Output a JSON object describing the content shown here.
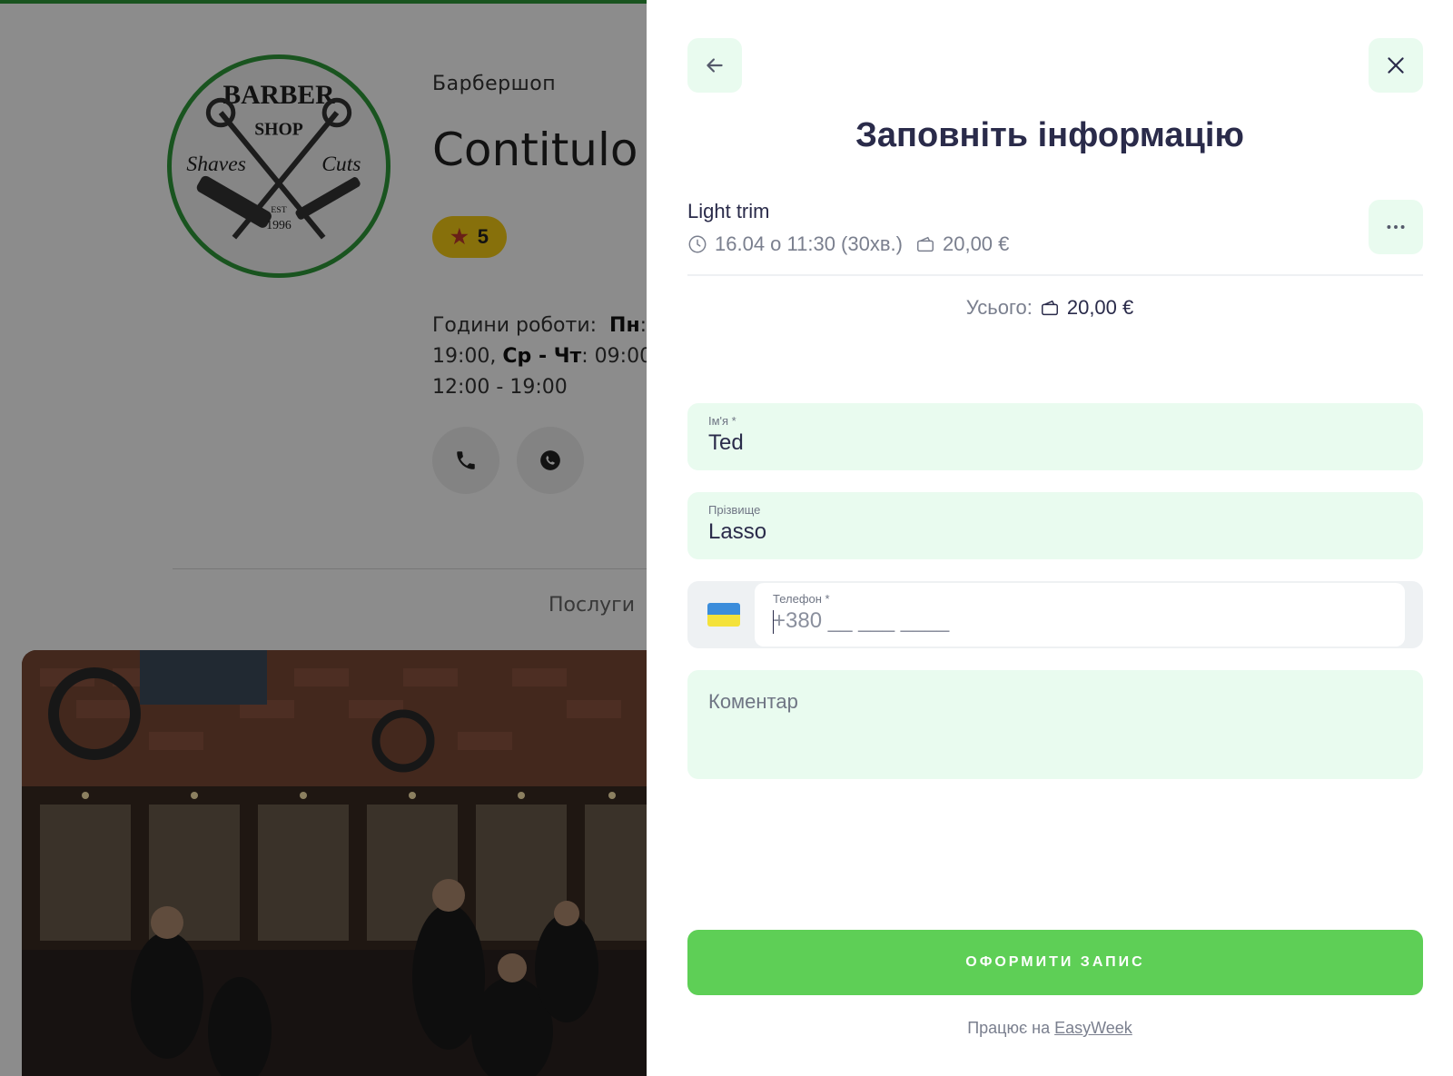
{
  "background": {
    "category": "Барбершоп",
    "business_name": "Contitulo",
    "rating": "5",
    "hours": {
      "label": "Години роботи:",
      "day1": "Пн",
      "frag1": ": (",
      "time1": "19:00,",
      "day2": "Ср - Чт",
      "frag2": ": 09:00 -",
      "line3": "12:00 - 19:00"
    },
    "services_tab": "Послуги",
    "logo_text": {
      "top": "BARBER",
      "shop": "SHOP",
      "left": "Shaves",
      "right": "Cuts",
      "est": "EST",
      "year": "1996"
    }
  },
  "drawer": {
    "title": "Заповніть інформацію",
    "service": {
      "name": "Light trim",
      "datetime": "16.04 о 11:30 (30хв.)",
      "price": "20,00 €"
    },
    "total": {
      "label": "Усього:",
      "amount": "20,00 €"
    },
    "form": {
      "first_name": {
        "label": "Ім'я *",
        "value": "Ted"
      },
      "last_name": {
        "label": "Прізвище",
        "value": "Lasso"
      },
      "phone": {
        "label": "Телефон *",
        "placeholder": "+380 __ ___ ____"
      },
      "comment": {
        "placeholder": "Коментар"
      }
    },
    "submit_label": "ОФОРМИТИ ЗАПИС",
    "powered_by": {
      "prefix": "Працює на",
      "link": "EasyWeek"
    }
  },
  "icons": [
    "arrow-left-icon",
    "close-icon",
    "more-icon",
    "clock-icon",
    "wallet-icon",
    "phone-icon",
    "whatsapp-icon",
    "star-icon",
    "ukraine-flag-icon"
  ],
  "colors": {
    "accent_green": "#5ecf56",
    "field_bg": "#e9fbef",
    "text_dark": "#2a2b4a",
    "rating_yellow": "#f6cc14",
    "logo_green": "#2f9a3a"
  }
}
